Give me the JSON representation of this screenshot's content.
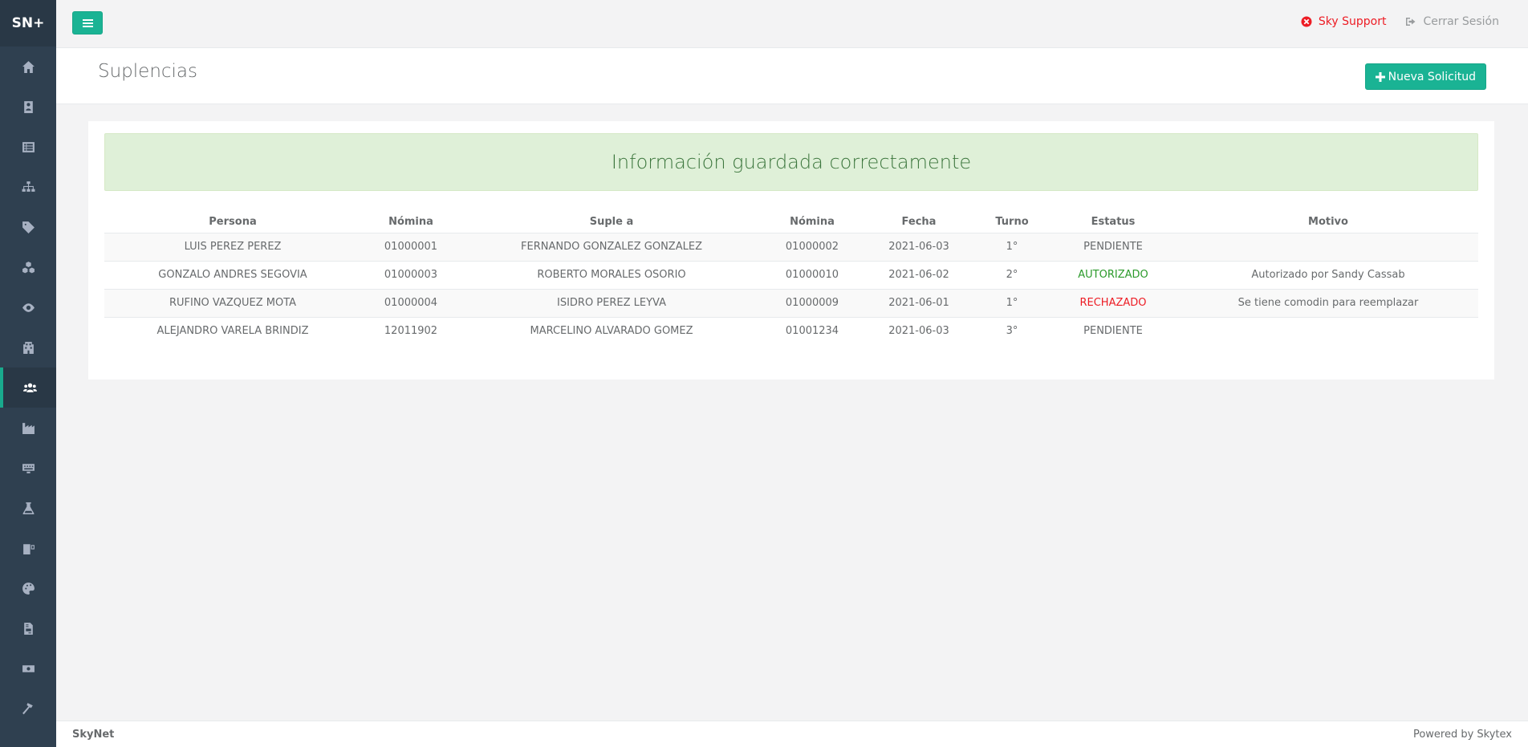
{
  "brand": "SN+",
  "sidebar": {
    "items": [
      {
        "icon": "home-icon"
      },
      {
        "icon": "address-book-icon"
      },
      {
        "icon": "list-icon"
      },
      {
        "icon": "sitemap-icon"
      },
      {
        "icon": "tag-icon"
      },
      {
        "icon": "cubes-icon"
      },
      {
        "icon": "eye-icon"
      },
      {
        "icon": "building-icon"
      },
      {
        "icon": "users-icon",
        "active": true
      },
      {
        "icon": "industry-icon"
      },
      {
        "icon": "keyboard-icon"
      },
      {
        "icon": "flask-icon"
      },
      {
        "icon": "dumpster-icon"
      },
      {
        "icon": "palette-icon"
      },
      {
        "icon": "file-invoice-icon"
      },
      {
        "icon": "money-bill-icon"
      },
      {
        "icon": "hammer-icon"
      }
    ]
  },
  "topbar": {
    "menu_icon": "bars-icon",
    "support_label": "Sky Support",
    "logout_label": "Cerrar Sesión"
  },
  "heading": {
    "title": "Suplencias",
    "new_button": "Nueva Solicitud"
  },
  "alert": {
    "message": "Información guardada correctamente"
  },
  "table": {
    "headers": [
      "Persona",
      "Nómina",
      "Suple a",
      "Nómina",
      "Fecha",
      "Turno",
      "Estatus",
      "Motivo"
    ],
    "rows": [
      {
        "persona": "LUIS PEREZ PEREZ",
        "nomina": "01000001",
        "suple_a": "FERNANDO GONZALEZ GONZALEZ",
        "nomina2": "01000002",
        "fecha": "2021-06-03",
        "turno": "1°",
        "estatus": "PENDIENTE",
        "motivo": ""
      },
      {
        "persona": "GONZALO ANDRES SEGOVIA",
        "nomina": "01000003",
        "suple_a": "ROBERTO MORALES OSORIO",
        "nomina2": "01000010",
        "fecha": "2021-06-02",
        "turno": "2°",
        "estatus": "AUTORIZADO",
        "motivo": "Autorizado por Sandy Cassab"
      },
      {
        "persona": "RUFINO VAZQUEZ MOTA",
        "nomina": "01000004",
        "suple_a": "ISIDRO PEREZ LEYVA",
        "nomina2": "01000009",
        "fecha": "2021-06-01",
        "turno": "1°",
        "estatus": "RECHAZADO",
        "motivo": "Se tiene comodin para reemplazar"
      },
      {
        "persona": "ALEJANDRO VARELA BRINDIZ",
        "nomina": "12011902",
        "suple_a": "MARCELINO ALVARADO GOMEZ",
        "nomina2": "01001234",
        "fecha": "2021-06-03",
        "turno": "3°",
        "estatus": "PENDIENTE",
        "motivo": ""
      }
    ]
  },
  "footer": {
    "left": "SkyNet",
    "right": "Powered by Skytex"
  },
  "colors": {
    "primary": "#1ab394",
    "sidebar": "#2f4050",
    "alert_bg": "#dff0d8",
    "status_authorized": "#2b9a2b",
    "status_rejected": "#ed1c24"
  }
}
